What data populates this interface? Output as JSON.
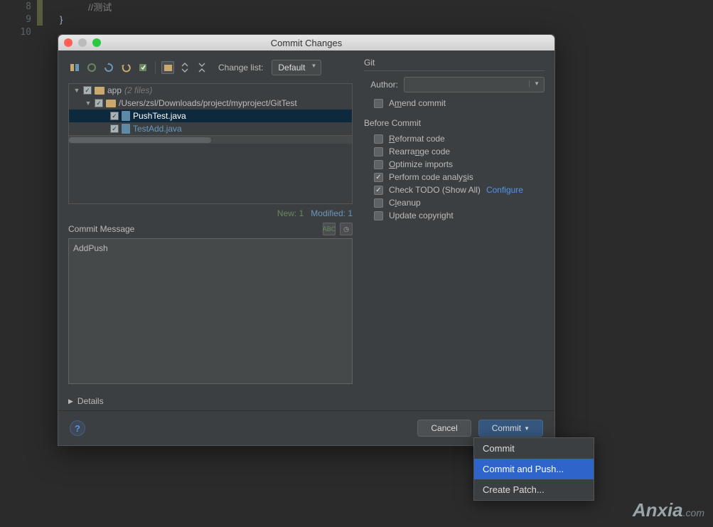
{
  "editor": {
    "lines": [
      "8",
      "9",
      "10"
    ],
    "comment": "//测试",
    "brace": "}"
  },
  "dialog": {
    "title": "Commit Changes",
    "changelist_label": "Change list:",
    "changelist_value": "Default",
    "tree": {
      "root": {
        "label": "app",
        "count": "(2 files)"
      },
      "path": "/Users/zsl/Downloads/project/myproject/GitTest",
      "files": [
        "PushTest.java",
        "TestAdd.java"
      ]
    },
    "status": {
      "new": "New: 1",
      "modified": "Modified: 1"
    },
    "commit_message": {
      "label": "Commit Message",
      "value": "AddPush"
    },
    "details": "Details",
    "git": {
      "header": "Git",
      "author_label": "Author:",
      "amend": "Amend commit"
    },
    "before_commit": {
      "header": "Before Commit",
      "items": [
        {
          "label": "Reformat code",
          "checked": false
        },
        {
          "label": "Rearrange code",
          "checked": false
        },
        {
          "label": "Optimize imports",
          "checked": false
        },
        {
          "label": "Perform code analysis",
          "checked": true
        },
        {
          "label": "Check TODO (Show All)",
          "checked": true,
          "link": "Configure"
        },
        {
          "label": "Cleanup",
          "checked": false
        },
        {
          "label": "Update copyright",
          "checked": false
        }
      ]
    },
    "footer": {
      "cancel": "Cancel",
      "commit": "Commit"
    },
    "menu": {
      "items": [
        "Commit",
        "Commit and Push...",
        "Create Patch..."
      ]
    }
  },
  "watermark": {
    "brand": "Anxia",
    "suffix": ".com"
  }
}
